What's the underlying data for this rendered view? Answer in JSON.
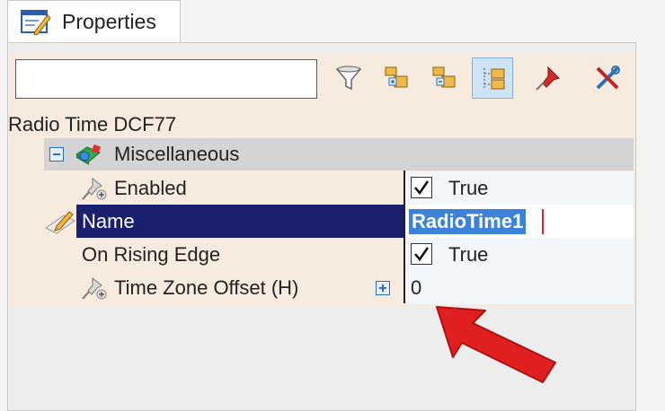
{
  "tab": {
    "label": "Properties",
    "icon": "properties-window-icon"
  },
  "toolbar": {
    "search_value": "",
    "buttons": [
      {
        "name": "filter-button",
        "icon": "funnel-icon",
        "active": false
      },
      {
        "name": "categorized-button",
        "icon": "categorized-icon",
        "active": false
      },
      {
        "name": "alphabetical-button",
        "icon": "alphabetical-icon",
        "active": false
      },
      {
        "name": "property-pages-button",
        "icon": "property-pages-icon",
        "active": true
      },
      {
        "name": "pin-button",
        "icon": "pushpin-icon",
        "active": false
      },
      {
        "name": "tools-button",
        "icon": "tools-icon",
        "active": false
      }
    ]
  },
  "object_name": "Radio Time DCF77",
  "category": {
    "label": "Miscellaneous",
    "expanded": true
  },
  "properties": [
    {
      "label": "Enabled",
      "value": "True",
      "type": "bool",
      "checked": true
    },
    {
      "label": "Name",
      "value": "RadioTime1",
      "type": "text",
      "selected": true
    },
    {
      "label": "On Rising Edge",
      "value": "True",
      "type": "bool",
      "checked": true
    },
    {
      "label": "Time Zone Offset (H)",
      "value": "0",
      "type": "text"
    }
  ],
  "colors": {
    "selection": "#1a1f6e",
    "edit_highlight": "#3b82d8",
    "panel_bg": "#f7ebe0",
    "arrow": "#e02020"
  }
}
